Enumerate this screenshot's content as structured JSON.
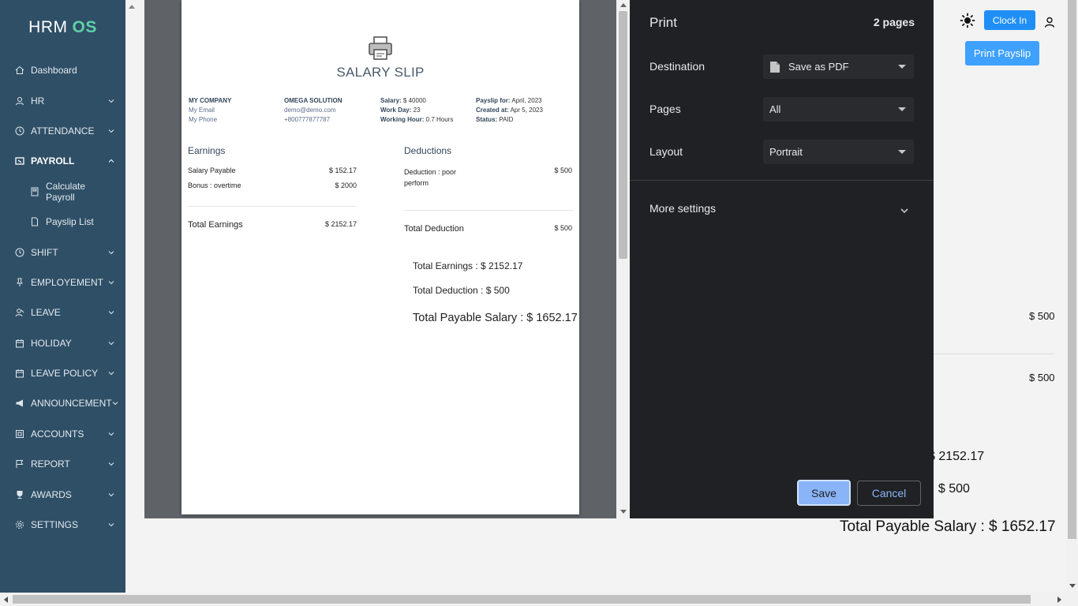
{
  "app": {
    "brand_main": "HRM",
    "brand_accent": "OS"
  },
  "sidebar": {
    "items": [
      {
        "label": "Dashboard"
      },
      {
        "label": "HR"
      },
      {
        "label": "ATTENDANCE"
      },
      {
        "label": "PAYROLL"
      },
      {
        "label": "Calculate Payroll"
      },
      {
        "label": "Payslip List"
      },
      {
        "label": "SHIFT"
      },
      {
        "label": "EMPLOYEMENT"
      },
      {
        "label": "LEAVE"
      },
      {
        "label": "HOLIDAY"
      },
      {
        "label": "LEAVE POLICY"
      },
      {
        "label": "ANNOUNCEMENT"
      },
      {
        "label": "ACCOUNTS"
      },
      {
        "label": "REPORT"
      },
      {
        "label": "AWARDS"
      },
      {
        "label": "SETTINGS"
      }
    ]
  },
  "topbar": {
    "clock_in": "Clock In",
    "print_payslip": "Print Payslip"
  },
  "background": {
    "deduction_val": "$ 500",
    "total_deduction_val": "$ 500",
    "total_earnings_partial": "$ 2152.17",
    "total_deduction_partial": ": $ 500",
    "total_payable": "Total Payable Salary : $ 1652.17"
  },
  "slip": {
    "title": "SALARY SLIP",
    "company": {
      "name": "MY COMPANY",
      "email": "My Email",
      "phone": "My Phone"
    },
    "employee": {
      "name": "OMEGA SOLUTION",
      "email": "demo@demo.com",
      "phone": "+800777877787"
    },
    "salary_info": {
      "salary_label": "Salary:",
      "salary": "$ 40000",
      "work_day_label": "Work Day:",
      "work_day": "23",
      "working_hour_label": "Working Hour:",
      "working_hour": "0.7 Hours"
    },
    "payslip_info": {
      "for_label": "Payslip for:",
      "for": "April, 2023",
      "created_label": "Created at:",
      "created": "Apr 5, 2023",
      "status_label": "Status:",
      "status": "PAID"
    },
    "earnings": {
      "heading": "Earnings",
      "rows": [
        {
          "name": "Salary Payable",
          "value": "$ 152.17"
        },
        {
          "name": "Bonus : overtime",
          "value": "$ 2000"
        }
      ],
      "total_label": "Total Earnings",
      "total_value": "$ 2152.17"
    },
    "deductions": {
      "heading": "Deductions",
      "rows": [
        {
          "name_line1": "Deduction : poor",
          "name_line2": "perform",
          "value": "$ 500"
        }
      ],
      "total_label": "Total Deduction",
      "total_value": "$ 500"
    },
    "summary": {
      "total_earnings": "Total Earnings : $ 2152.17",
      "total_deduction": "Total Deduction : $ 500",
      "total_payable": "Total Payable Salary : $ 1652.17"
    }
  },
  "print_panel": {
    "title": "Print",
    "page_count": "2 pages",
    "destination_label": "Destination",
    "destination_value": "Save as PDF",
    "pages_label": "Pages",
    "pages_value": "All",
    "layout_label": "Layout",
    "layout_value": "Portrait",
    "more_settings": "More settings",
    "save": "Save",
    "cancel": "Cancel"
  },
  "colors": {
    "sidebar_bg": "#2f4f66",
    "brand_accent": "#5fd0a8",
    "primary_button": "#1f8ff5",
    "print_panel_bg": "#202124",
    "save_button": "#8ab4f8"
  }
}
